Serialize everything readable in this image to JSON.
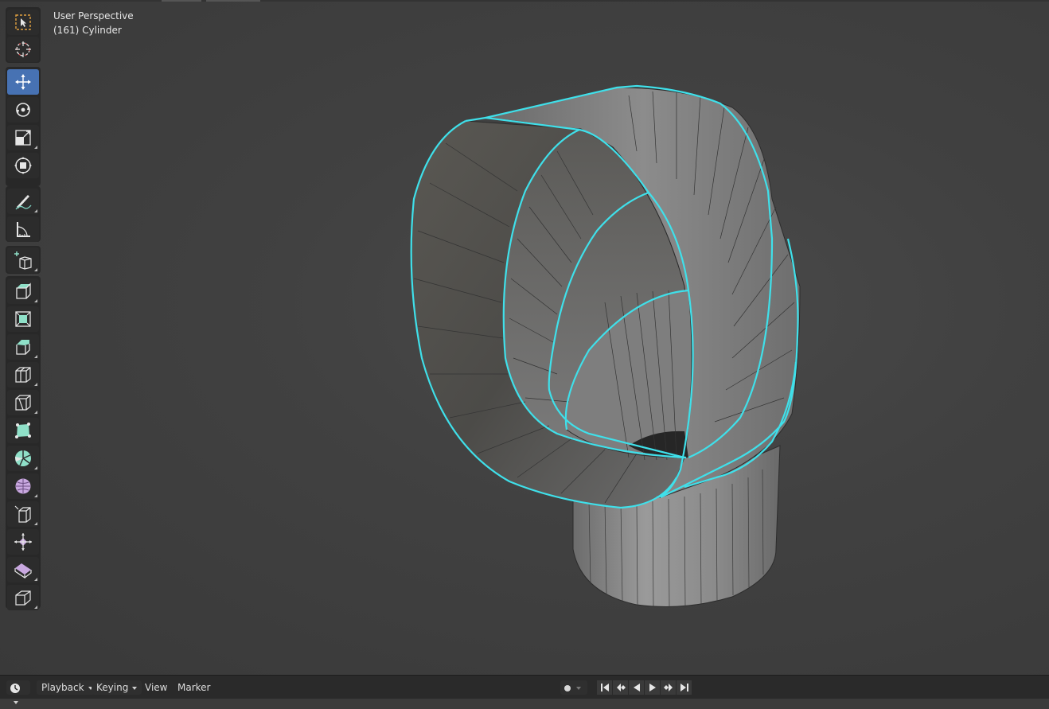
{
  "viewport": {
    "view_name": "User Perspective",
    "object_info": "(161) Cylinder"
  },
  "toolbar": {
    "active_tool": "move",
    "tools": [
      {
        "id": "select-box",
        "icon": "select-box-icon"
      },
      {
        "id": "cursor",
        "icon": "cursor-icon"
      },
      {
        "id": "move",
        "icon": "move-icon"
      },
      {
        "id": "rotate",
        "icon": "rotate-icon"
      },
      {
        "id": "scale",
        "icon": "scale-icon"
      },
      {
        "id": "transform",
        "icon": "transform-icon"
      },
      {
        "id": "annotate",
        "icon": "annotate-icon"
      },
      {
        "id": "measure",
        "icon": "measure-icon"
      },
      {
        "id": "add-cube",
        "icon": "add-cube-icon"
      },
      {
        "id": "extrude-region",
        "icon": "extrude-region-icon"
      },
      {
        "id": "inset-faces",
        "icon": "inset-faces-icon"
      },
      {
        "id": "bevel",
        "icon": "bevel-icon"
      },
      {
        "id": "loop-cut",
        "icon": "loop-cut-icon"
      },
      {
        "id": "knife",
        "icon": "knife-icon"
      },
      {
        "id": "poly-build",
        "icon": "poly-build-icon"
      },
      {
        "id": "spin",
        "icon": "spin-icon"
      },
      {
        "id": "smooth",
        "icon": "smooth-icon"
      },
      {
        "id": "edge-slide",
        "icon": "edge-slide-icon"
      },
      {
        "id": "shrink-fatten",
        "icon": "shrink-fatten-icon"
      },
      {
        "id": "shear",
        "icon": "shear-icon"
      },
      {
        "id": "rip-region",
        "icon": "rip-region-icon"
      }
    ]
  },
  "colors": {
    "selection_edge": "#3fe0ea",
    "active_tool_bg": "#4772b3",
    "mesh_fill": "#6b6b6b"
  },
  "timeline": {
    "editor_type_icon": "clock-icon",
    "menus": {
      "playback": "Playback",
      "keying": "Keying",
      "view": "View",
      "marker": "Marker"
    },
    "playback_controls": [
      "jump-start-icon",
      "prev-keyframe-icon",
      "play-reverse-icon",
      "play-icon",
      "next-keyframe-icon",
      "jump-end-icon"
    ],
    "record_icon": "record-icon"
  }
}
